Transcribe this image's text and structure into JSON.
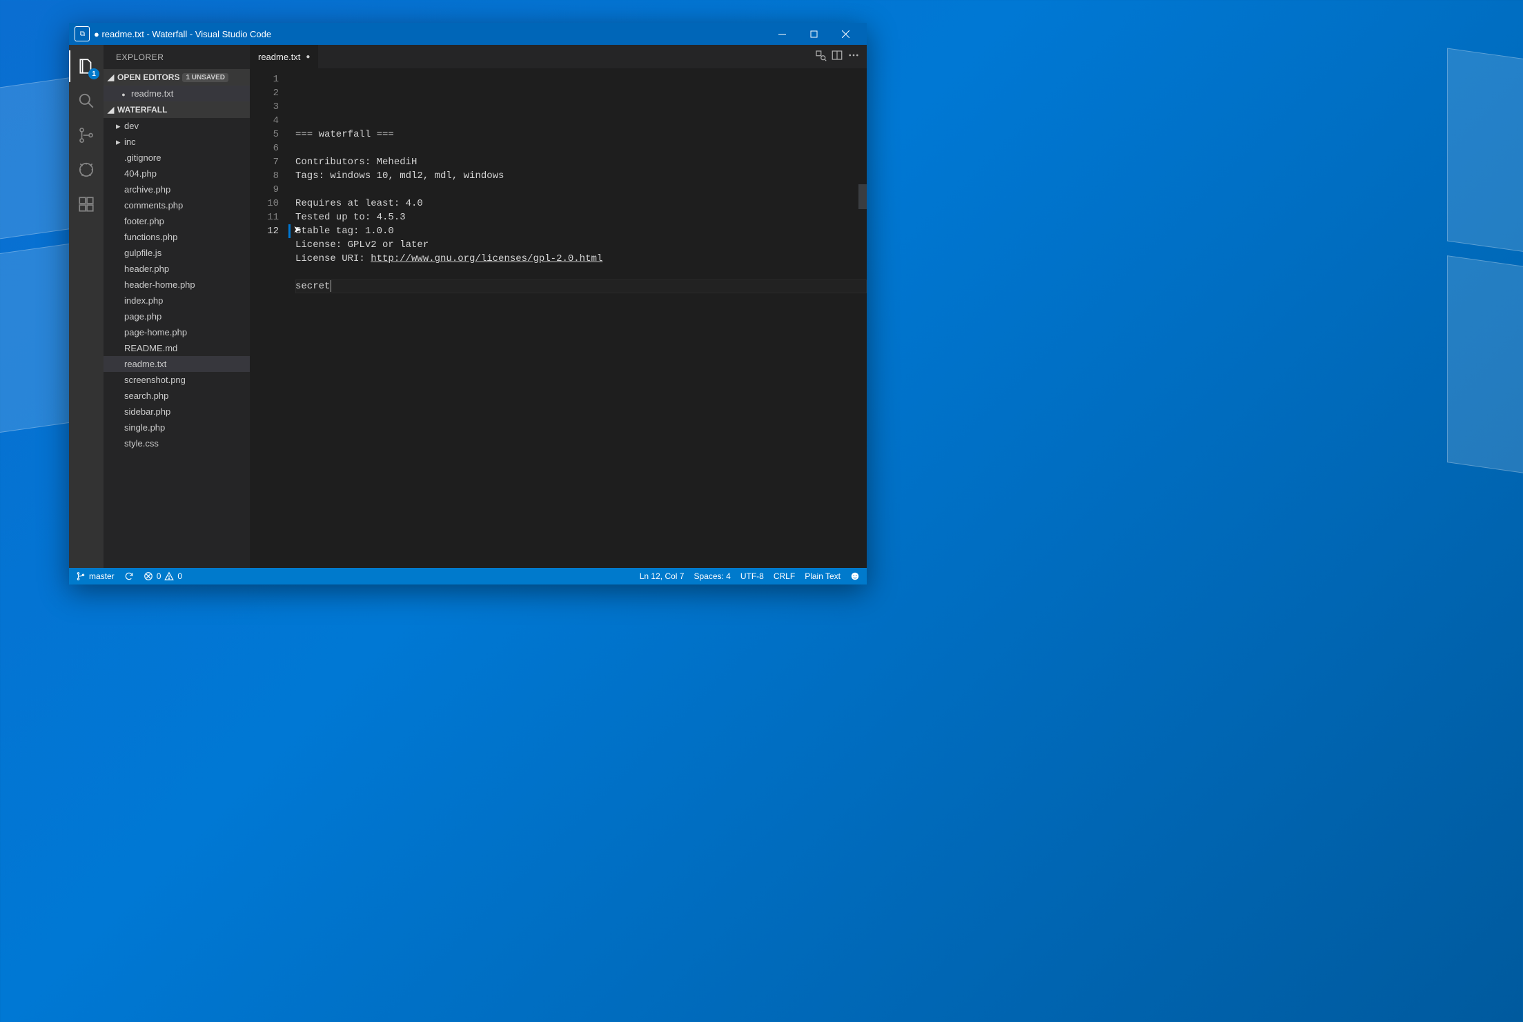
{
  "window": {
    "title": "● readme.txt - Waterfall - Visual Studio Code",
    "app_icon_glyph": "⧉"
  },
  "activitybar": {
    "badge": "1"
  },
  "sidebar": {
    "title": "EXPLORER",
    "open_editors": {
      "label": "OPEN EDITORS",
      "badge": "1 UNSAVED",
      "items": [
        {
          "label": "readme.txt",
          "unsaved": true
        }
      ]
    },
    "project": {
      "label": "WATERFALL",
      "tree": [
        {
          "kind": "folder",
          "label": "dev"
        },
        {
          "kind": "folder",
          "label": "inc"
        },
        {
          "kind": "file",
          "label": ".gitignore"
        },
        {
          "kind": "file",
          "label": "404.php"
        },
        {
          "kind": "file",
          "label": "archive.php"
        },
        {
          "kind": "file",
          "label": "comments.php"
        },
        {
          "kind": "file",
          "label": "footer.php"
        },
        {
          "kind": "file",
          "label": "functions.php"
        },
        {
          "kind": "file",
          "label": "gulpfile.js"
        },
        {
          "kind": "file",
          "label": "header.php"
        },
        {
          "kind": "file",
          "label": "header-home.php"
        },
        {
          "kind": "file",
          "label": "index.php"
        },
        {
          "kind": "file",
          "label": "page.php"
        },
        {
          "kind": "file",
          "label": "page-home.php"
        },
        {
          "kind": "file",
          "label": "README.md"
        },
        {
          "kind": "file",
          "label": "readme.txt",
          "selected": true
        },
        {
          "kind": "file",
          "label": "screenshot.png"
        },
        {
          "kind": "file",
          "label": "search.php"
        },
        {
          "kind": "file",
          "label": "sidebar.php"
        },
        {
          "kind": "file",
          "label": "single.php"
        },
        {
          "kind": "file",
          "label": "style.css"
        }
      ]
    }
  },
  "tabs": {
    "active": {
      "label": "readme.txt",
      "modified": true
    }
  },
  "editor": {
    "active_line": 12,
    "lines": [
      "=== waterfall ===",
      "",
      "Contributors: MehediH",
      "Tags: windows 10, mdl2, mdl, windows",
      "",
      "Requires at least: 4.0",
      "Tested up to: 4.5.3",
      "Stable tag: 1.0.0",
      "License: GPLv2 or later",
      "",
      "",
      "secret"
    ],
    "line10_prefix": "License URI: ",
    "line10_link": "http://www.gnu.org/licenses/gpl-2.0.html"
  },
  "status": {
    "branch": "master",
    "errors": "0",
    "warnings": "0",
    "position": "Ln 12, Col 7",
    "spaces": "Spaces: 4",
    "encoding": "UTF-8",
    "eol": "CRLF",
    "language": "Plain Text"
  }
}
